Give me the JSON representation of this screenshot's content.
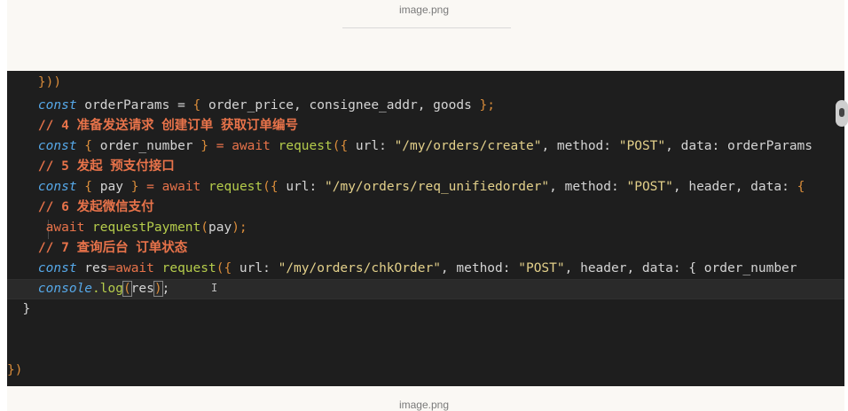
{
  "captions": {
    "top": "image.png",
    "bottom": "image.png"
  },
  "code": {
    "l0": "}))",
    "l1_kw": "const",
    "l1_a": " orderParams = ",
    "l1_b": "{",
    "l1_c": " order_price, consignee_addr, goods ",
    "l1_d": "};",
    "l2": "// 4 准备发送请求 创建订单 获取订单编号",
    "l3_kw": "const",
    "l3_b1": " { ",
    "l3_a": "order_number ",
    "l3_b2": "}",
    "l3_op": " = ",
    "l3_await": "await",
    "l3_fn": " request",
    "l3_p": "({",
    "l3_u": " url: ",
    "l3_s1": "\"/my/orders/create\"",
    "l3_m": ", method: ",
    "l3_s2": "\"POST\"",
    "l3_rest": ", data: orderParams",
    "l4": "// 5 发起 预支付接口",
    "l5_kw": "const",
    "l5_b1": " { ",
    "l5_a": "pay ",
    "l5_b2": "}",
    "l5_op": " = ",
    "l5_await": "await",
    "l5_fn": " request",
    "l5_p": "({",
    "l5_u": " url: ",
    "l5_s1": "\"/my/orders/req_unifiedorder\"",
    "l5_m": ", method: ",
    "l5_s2": "\"POST\"",
    "l5_rest": ", header, data: ",
    "l5_end": "{",
    "l6": "// 6 发起微信支付",
    "l7_await": "await",
    "l7_fn": " requestPayment",
    "l7_p1": "(",
    "l7_a": "pay",
    "l7_p2": ");",
    "l8": "// 7 查询后台 订单状态",
    "l9_kw": "const",
    "l9_a": " res",
    "l9_op": "=",
    "l9_await": "await",
    "l9_fn": " request",
    "l9_p": "({",
    "l9_u": " url: ",
    "l9_s1": "\"/my/orders/chkOrder\"",
    "l9_m": ", method: ",
    "l9_s2": "\"POST\"",
    "l9_rest": ", header, data: { order_number",
    "l10_kw": "console",
    "l10_fn": ".log",
    "l10_p1": "(",
    "l10_a": "res",
    "l10_p2": ")",
    "l10_end": ";",
    "l11": "}",
    "l14": "})"
  },
  "colors": {
    "editor_bg": "#1e1e1e",
    "keyword": "#56a8e8",
    "await": "#e8734a",
    "function": "#b5cc4b",
    "string": "#e3d08a",
    "comment": "#e8734a"
  }
}
